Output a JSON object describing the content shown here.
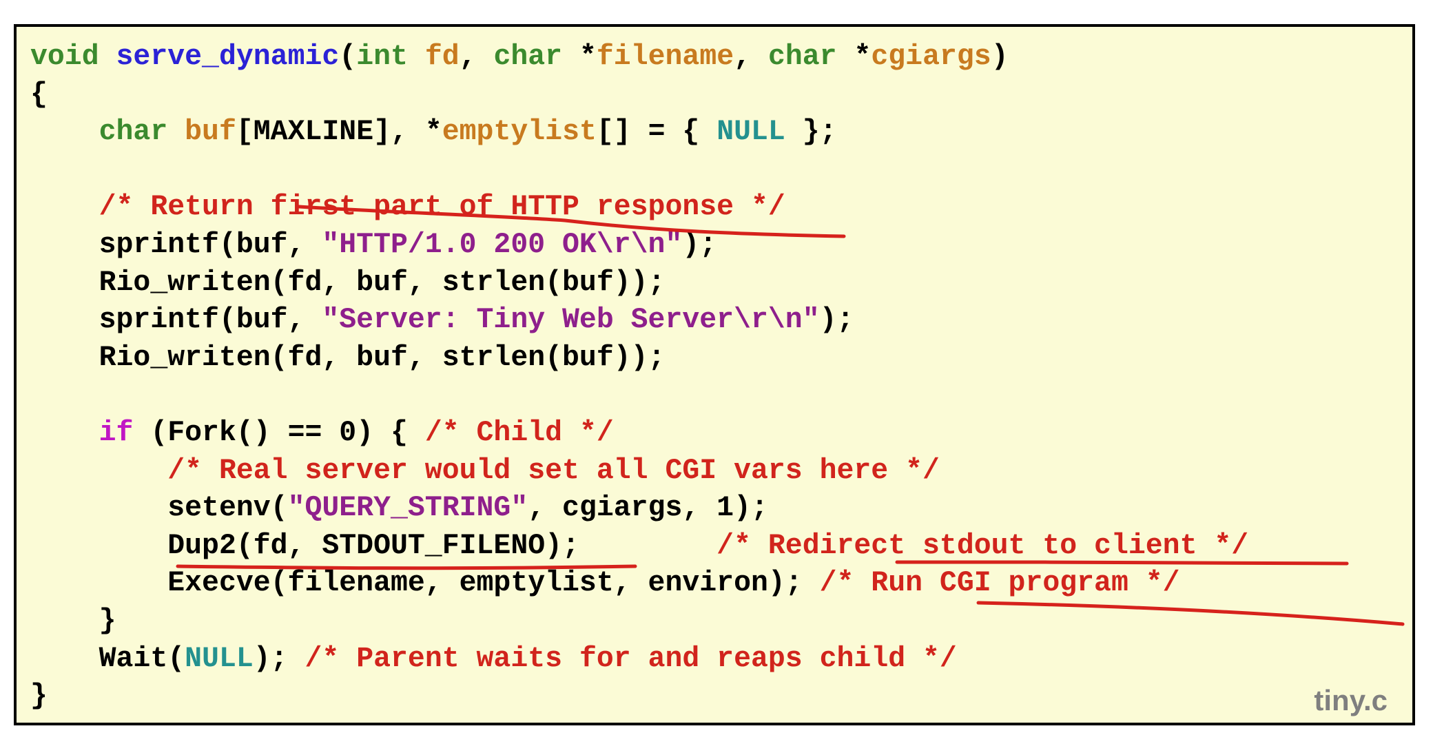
{
  "colors": {
    "default": "#000000",
    "keyword": "#3b8a2e",
    "function_name": "#2b22d6",
    "identifier": "#c87a1f",
    "string": "#8e1f8c",
    "comment": "#d1241c",
    "constant": "#24918f",
    "control": "#c016c4",
    "ink": "#d6221c"
  },
  "code": {
    "lines": [
      [
        {
          "t": "void ",
          "c": "keyword"
        },
        {
          "t": "serve_dynamic",
          "c": "function_name"
        },
        {
          "t": "(",
          "c": "default"
        },
        {
          "t": "int",
          "c": "keyword"
        },
        {
          "t": " ",
          "c": "default"
        },
        {
          "t": "fd",
          "c": "identifier"
        },
        {
          "t": ", ",
          "c": "default"
        },
        {
          "t": "char",
          "c": "keyword"
        },
        {
          "t": " *",
          "c": "default"
        },
        {
          "t": "filename",
          "c": "identifier"
        },
        {
          "t": ", ",
          "c": "default"
        },
        {
          "t": "char",
          "c": "keyword"
        },
        {
          "t": " *",
          "c": "default"
        },
        {
          "t": "cgiargs",
          "c": "identifier"
        },
        {
          "t": ")",
          "c": "default"
        }
      ],
      [
        {
          "t": "{",
          "c": "default"
        }
      ],
      [
        {
          "t": "    ",
          "c": "default"
        },
        {
          "t": "char",
          "c": "keyword"
        },
        {
          "t": " ",
          "c": "default"
        },
        {
          "t": "buf",
          "c": "identifier"
        },
        {
          "t": "[MAXLINE], *",
          "c": "default"
        },
        {
          "t": "emptylist",
          "c": "identifier"
        },
        {
          "t": "[] = { ",
          "c": "default"
        },
        {
          "t": "NULL",
          "c": "constant"
        },
        {
          "t": " };",
          "c": "default"
        }
      ],
      [],
      [
        {
          "t": "    ",
          "c": "default"
        },
        {
          "t": "/* Return first part of HTTP response */",
          "c": "comment"
        }
      ],
      [
        {
          "t": "    sprintf(buf, ",
          "c": "default"
        },
        {
          "t": "\"HTTP/1.0 200 OK\\r\\n\"",
          "c": "string"
        },
        {
          "t": ");",
          "c": "default"
        }
      ],
      [
        {
          "t": "    Rio_writen(fd, buf, strlen(buf));",
          "c": "default"
        }
      ],
      [
        {
          "t": "    sprintf(buf, ",
          "c": "default"
        },
        {
          "t": "\"Server: Tiny Web Server\\r\\n\"",
          "c": "string"
        },
        {
          "t": ");",
          "c": "default"
        }
      ],
      [
        {
          "t": "    Rio_writen(fd, buf, strlen(buf));",
          "c": "default"
        }
      ],
      [],
      [
        {
          "t": "    ",
          "c": "default"
        },
        {
          "t": "if",
          "c": "control"
        },
        {
          "t": " (Fork() == 0) { ",
          "c": "default"
        },
        {
          "t": "/* Child */",
          "c": "comment"
        }
      ],
      [
        {
          "t": "        ",
          "c": "default"
        },
        {
          "t": "/* Real server would set all CGI vars here */",
          "c": "comment"
        }
      ],
      [
        {
          "t": "        setenv(",
          "c": "default"
        },
        {
          "t": "\"QUERY_STRING\"",
          "c": "string"
        },
        {
          "t": ", cgiargs, 1);",
          "c": "default"
        }
      ],
      [
        {
          "t": "        Dup2(fd, STDOUT_FILENO);        ",
          "c": "default"
        },
        {
          "t": "/* Redirect stdout to client */",
          "c": "comment"
        }
      ],
      [
        {
          "t": "        Execve(filename, emptylist, environ); ",
          "c": "default"
        },
        {
          "t": "/* Run CGI program */",
          "c": "comment"
        }
      ],
      [
        {
          "t": "    }",
          "c": "default"
        }
      ],
      [
        {
          "t": "    Wait(",
          "c": "default"
        },
        {
          "t": "NULL",
          "c": "constant"
        },
        {
          "t": "); ",
          "c": "default"
        },
        {
          "t": "/* Parent waits for and reaps child */",
          "c": "comment"
        }
      ],
      [
        {
          "t": "}",
          "c": "default"
        }
      ]
    ]
  },
  "file_label": "tiny.c"
}
